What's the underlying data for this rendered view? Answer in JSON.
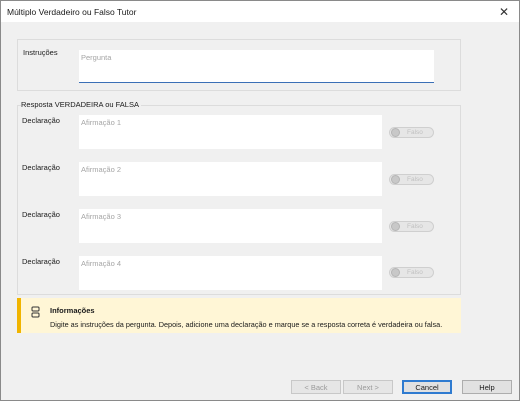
{
  "window": {
    "title": "Múltiplo Verdadeiro ou Falso Tutor",
    "close_symbol": "✕"
  },
  "instructions": {
    "label": "Instruções",
    "placeholder": "Pergunta"
  },
  "response_group": {
    "title": "Resposta VERDADEIRA ou FALSA",
    "statements": [
      {
        "label": "Declaração",
        "placeholder": "Afirmação 1",
        "toggle_label": "Falso"
      },
      {
        "label": "Declaração",
        "placeholder": "Afirmação 2",
        "toggle_label": "Falso"
      },
      {
        "label": "Declaração",
        "placeholder": "Afirmação 3",
        "toggle_label": "Falso"
      },
      {
        "label": "Declaração",
        "placeholder": "Afirmação 4",
        "toggle_label": "Falso"
      }
    ]
  },
  "info": {
    "title": "Informações",
    "text": "Digite as instruções da pergunta. Depois, adicione uma declaração e marque se a resposta correta é verdadeira ou falsa.",
    "icon": "info-icon",
    "accent_color": "#f0b400",
    "background_color": "#fff6d6"
  },
  "buttons": {
    "back": "< Back",
    "next": "Next >",
    "cancel": "Cancel",
    "help": "Help"
  }
}
